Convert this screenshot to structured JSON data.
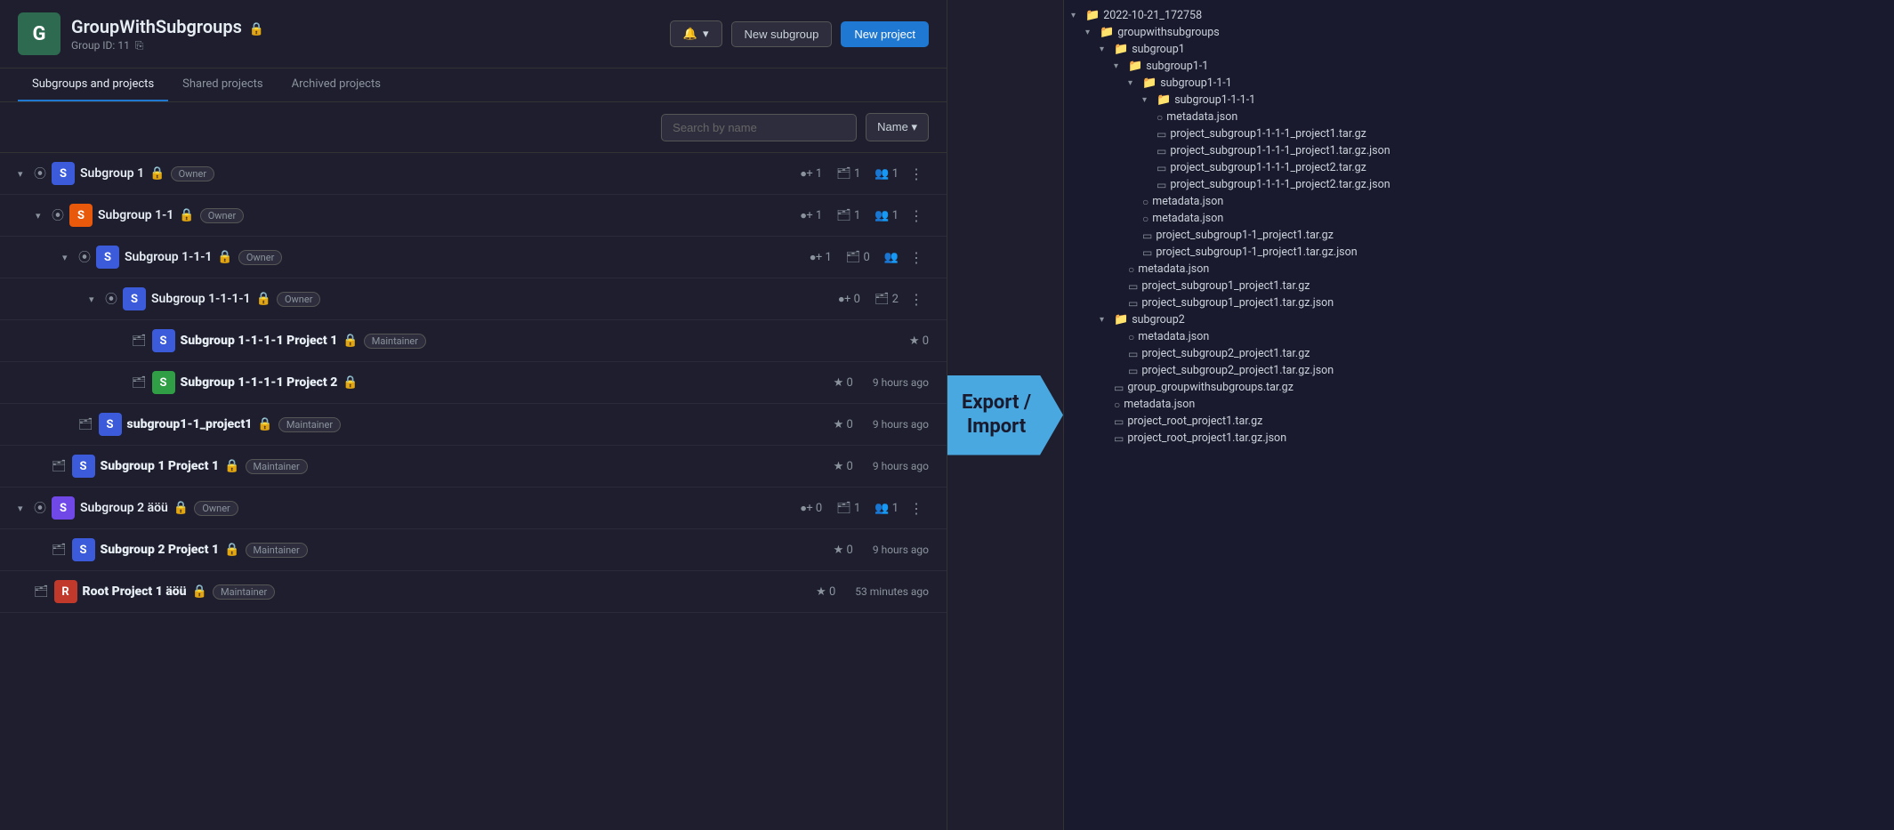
{
  "header": {
    "group_letter": "G",
    "group_name": "GroupWithSubgroups",
    "group_id_label": "Group ID: 11",
    "bell_label": "▾",
    "new_subgroup_label": "New subgroup",
    "new_project_label": "New project"
  },
  "tabs": {
    "tab1": "Subgroups and projects",
    "tab2": "Shared projects",
    "tab3": "Archived projects"
  },
  "search": {
    "placeholder": "Search by name",
    "sort_label": "Name ▾"
  },
  "items": [
    {
      "type": "subgroup",
      "indent": 0,
      "expanded": true,
      "name": "Subgroup 1",
      "badge": "Owner",
      "members": "1",
      "repos": "1",
      "users": "1"
    },
    {
      "type": "subgroup",
      "indent": 1,
      "expanded": true,
      "name": "Subgroup 1-1",
      "badge": "Owner",
      "members": "1",
      "repos": "1",
      "users": "1"
    },
    {
      "type": "subgroup",
      "indent": 2,
      "expanded": true,
      "name": "Subgroup 1-1-1",
      "badge": "Owner",
      "members": "1",
      "repos": "0",
      "users": ""
    },
    {
      "type": "subgroup",
      "indent": 3,
      "expanded": true,
      "name": "Subgroup 1-1-1-1",
      "badge": "Owner",
      "members": "0",
      "repos": "2",
      "users": ""
    },
    {
      "type": "project",
      "indent": 4,
      "color": "av-blue",
      "name": "Subgroup 1-1-1-1 Project 1",
      "badge": "Maintainer",
      "stars": "0",
      "time": ""
    },
    {
      "type": "project",
      "indent": 4,
      "color": "av-green",
      "name": "Subgroup 1-1-1-1 Project 2",
      "stars": "0",
      "time": "9 hours ago"
    },
    {
      "type": "project",
      "indent": 2,
      "color": "av-blue",
      "name": "subgroup1-1_project1",
      "badge": "Maintainer",
      "stars": "0",
      "time": "9 hours ago"
    },
    {
      "type": "project",
      "indent": 1,
      "color": "av-blue",
      "name": "Subgroup 1 Project 1",
      "badge": "Maintainer",
      "stars": "0",
      "time": "9 hours ago"
    },
    {
      "type": "subgroup",
      "indent": 0,
      "expanded": true,
      "name": "Subgroup 2 äöü",
      "badge": "Owner",
      "members": "0",
      "repos": "1",
      "users": "1"
    },
    {
      "type": "project",
      "indent": 1,
      "color": "av-blue",
      "name": "Subgroup 2 Project 1",
      "badge": "Maintainer",
      "stars": "0",
      "time": "9 hours ago"
    },
    {
      "type": "project",
      "indent": 0,
      "color": "av-red",
      "name": "Root Project 1 äöü",
      "badge": "Maintainer",
      "stars": "0",
      "time": "53 minutes ago"
    }
  ],
  "arrow": {
    "line1": "Export /",
    "line2": "Import"
  },
  "tree": [
    {
      "indent": 0,
      "type": "folder",
      "expanded": true,
      "label": "2022-10-21_172758"
    },
    {
      "indent": 1,
      "type": "folder",
      "expanded": true,
      "label": "groupwithsubgroups"
    },
    {
      "indent": 2,
      "type": "folder",
      "expanded": true,
      "label": "subgroup1"
    },
    {
      "indent": 3,
      "type": "folder",
      "expanded": true,
      "label": "subgroup1-1"
    },
    {
      "indent": 4,
      "type": "folder",
      "expanded": true,
      "label": "subgroup1-1-1"
    },
    {
      "indent": 5,
      "type": "folder",
      "expanded": true,
      "label": "subgroup1-1-1-1"
    },
    {
      "indent": 5,
      "type": "file",
      "label": "metadata.json"
    },
    {
      "indent": 5,
      "type": "file",
      "label": "project_subgroup1-1-1-1_project1.tar.gz"
    },
    {
      "indent": 5,
      "type": "file",
      "label": "project_subgroup1-1-1-1_project1.tar.gz.json"
    },
    {
      "indent": 5,
      "type": "file",
      "label": "project_subgroup1-1-1-1_project2.tar.gz"
    },
    {
      "indent": 5,
      "type": "file",
      "label": "project_subgroup1-1-1-1_project2.tar.gz.json"
    },
    {
      "indent": 4,
      "type": "file",
      "label": "metadata.json"
    },
    {
      "indent": 4,
      "type": "file",
      "label": "metadata.json"
    },
    {
      "indent": 4,
      "type": "file",
      "label": "project_subgroup1-1_project1.tar.gz"
    },
    {
      "indent": 4,
      "type": "file",
      "label": "project_subgroup1-1_project1.tar.gz.json"
    },
    {
      "indent": 3,
      "type": "file",
      "label": "metadata.json"
    },
    {
      "indent": 3,
      "type": "file",
      "label": "project_subgroup1_project1.tar.gz"
    },
    {
      "indent": 3,
      "type": "file",
      "label": "project_subgroup1_project1.tar.gz.json"
    },
    {
      "indent": 2,
      "type": "folder",
      "expanded": true,
      "label": "subgroup2"
    },
    {
      "indent": 3,
      "type": "file",
      "label": "metadata.json"
    },
    {
      "indent": 3,
      "type": "file",
      "label": "project_subgroup2_project1.tar.gz"
    },
    {
      "indent": 3,
      "type": "file",
      "label": "project_subgroup2_project1.tar.gz.json"
    },
    {
      "indent": 2,
      "type": "file",
      "label": "group_groupwithsubgroups.tar.gz"
    },
    {
      "indent": 2,
      "type": "file",
      "label": "metadata.json"
    },
    {
      "indent": 2,
      "type": "file",
      "label": "project_root_project1.tar.gz"
    },
    {
      "indent": 2,
      "type": "file",
      "label": "project_root_project1.tar.gz.json"
    }
  ]
}
